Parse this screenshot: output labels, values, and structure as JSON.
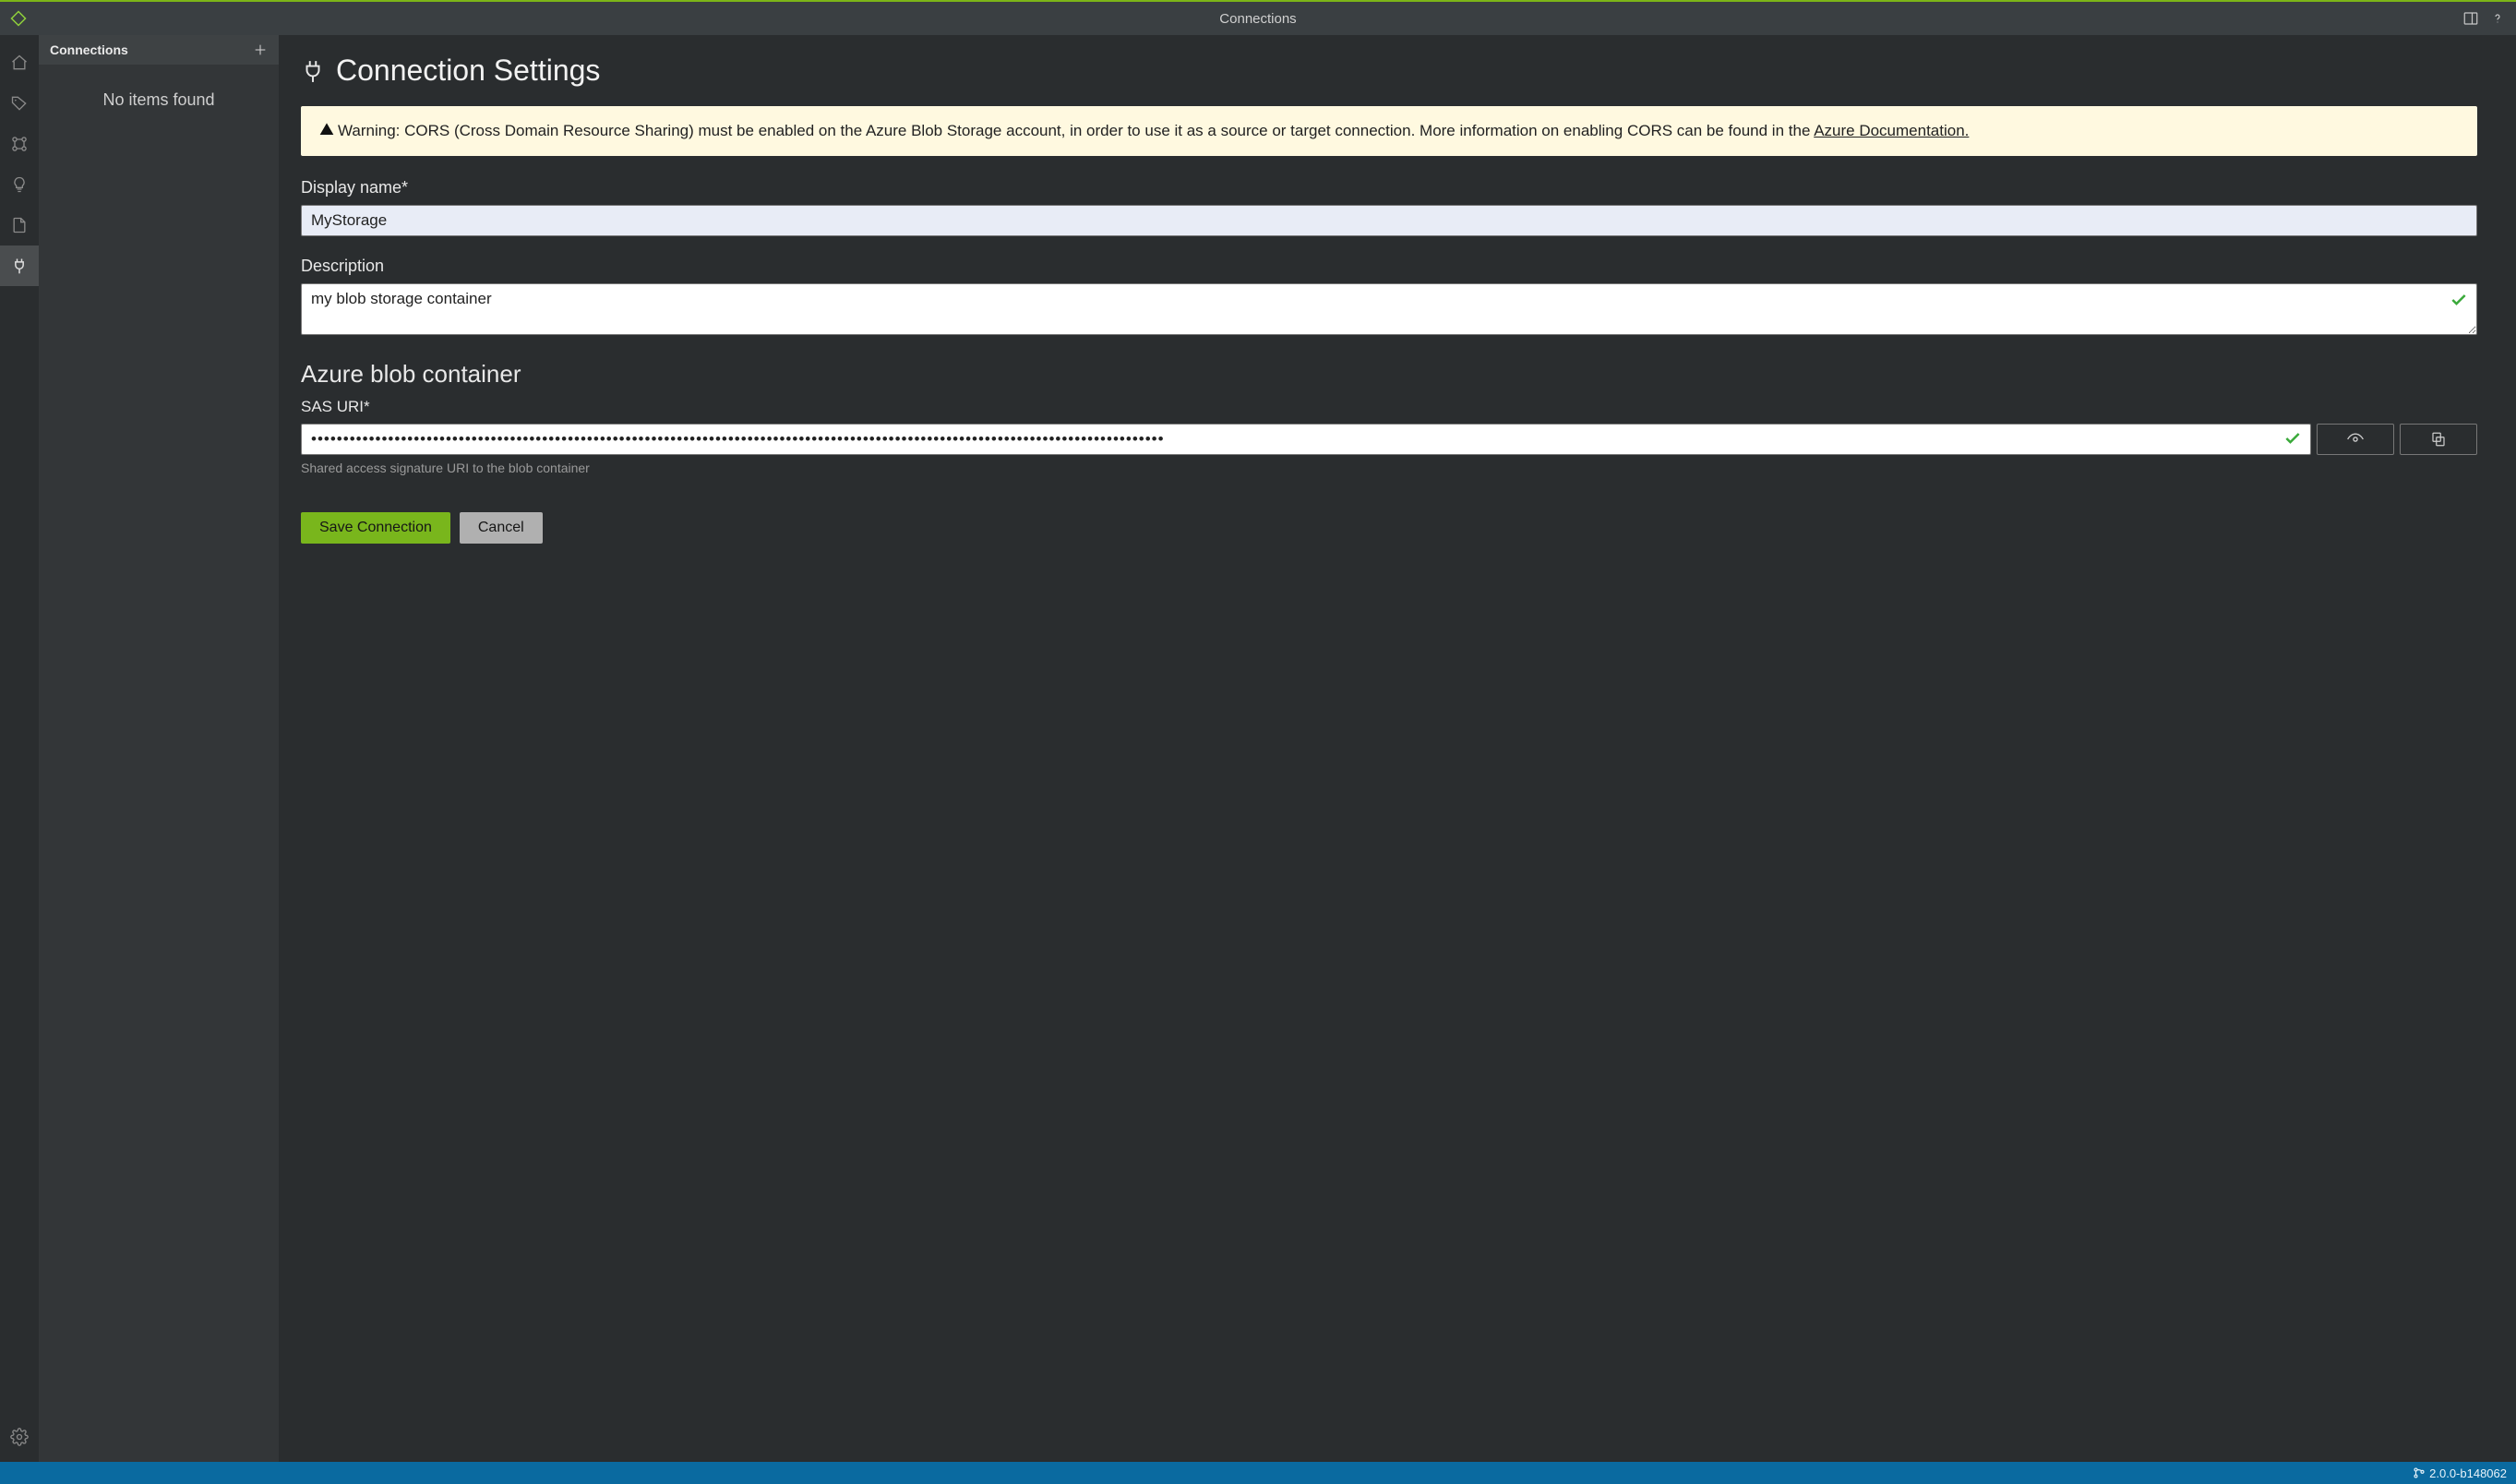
{
  "titlebar": {
    "title": "Connections"
  },
  "sidebar": {
    "header": "Connections",
    "empty_msg": "No items found"
  },
  "page": {
    "heading": "Connection Settings",
    "warning_prefix": "Warning: CORS (Cross Domain Resource Sharing) must be enabled on the Azure Blob Storage account, in order to use it as a source or target connection. More information on enabling CORS can be found in the ",
    "warning_link": "Azure Documentation.",
    "section_azure": "Azure blob container"
  },
  "form": {
    "display_name_label": "Display name*",
    "display_name_value": "MyStorage",
    "description_label": "Description",
    "description_value": "my blob storage container",
    "sas_label": "SAS URI*",
    "sas_value_mask": "•••••••••••••••••••••••••••••••••••••••••••••••••••••••••••••••••••••••••••••••••••••••••••••••••••••••••••••••••••••••••••••••••••••",
    "sas_helper": "Shared access signature URI to the blob container"
  },
  "buttons": {
    "save": "Save Connection",
    "cancel": "Cancel"
  },
  "status": {
    "version": "2.0.0-b148062"
  }
}
